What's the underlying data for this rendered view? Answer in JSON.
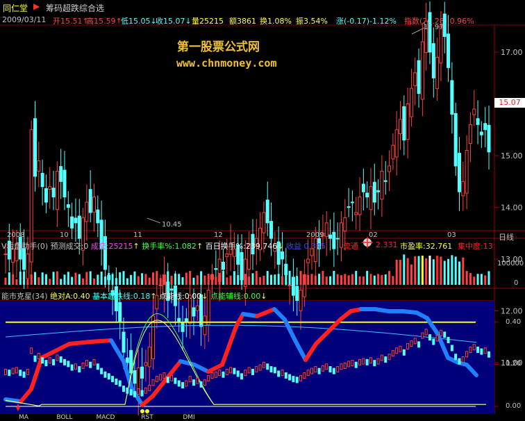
{
  "titlebar": {
    "stock_name": "同仁堂",
    "indicator_name": "筹码超跌综合选"
  },
  "quote": {
    "date": "2009/03/11",
    "open_label": "开",
    "open": "15.51",
    "high_label": "高",
    "high": "15.59",
    "low_label": "低",
    "low": "15.05",
    "close_label": "收",
    "close": "15.07",
    "vol_label": "量",
    "vol": "25215",
    "amt_label": "额",
    "amt": "3861",
    "turn_label": "换",
    "turn": "1.08%",
    "amp_label": "振",
    "amp": "3.54%",
    "chg_label": "涨",
    "chg": "(-0.17)-1.12%",
    "index_label": "指数",
    "index": "(20.28)",
    "index_pct": "0.96%"
  },
  "watermark": {
    "line1": "第一股票公式网",
    "line2": "www.chnmoney.com"
  },
  "price_panel": {
    "y_ticks": [
      "17.00",
      "16.00",
      "15.00",
      "14.00",
      "13.00",
      "12.00",
      "11.00"
    ],
    "current_price": "15.07",
    "max_label": "17.97",
    "min_label": "10.45"
  },
  "date_axis": {
    "labels": [
      "2008",
      "10",
      "11",
      "12",
      "2009",
      "02",
      "03"
    ],
    "period": "日线"
  },
  "volume_panel": {
    "name": "V看盘助手(0)",
    "forecast_label": "预测成交:0",
    "vol_label": "成交:",
    "vol": "25215",
    "turn_label": "换手率%:",
    "turn": "1.082",
    "hundred_label": "百日换手%:",
    "hundred": "239.746",
    "ret_label": "收益",
    "ret": "0.345",
    "float_label": "流通",
    "float_val": "2.331",
    "pe_label": "市盈率:",
    "pe": "32.761",
    "conc_label": "集中度:",
    "conc": "13",
    "y_ticks": [
      "100000",
      "0"
    ]
  },
  "indicator_panel": {
    "name": "能市克星(34)",
    "abs_label": "绝对A:",
    "abs": "0.40",
    "base_label": "基本超跌线:",
    "base": "0.18",
    "dot_label": "点能线:",
    "dot": "0.00",
    "aux_label": "点能辅线:",
    "aux": "0.00",
    "y_ticks": [
      "0.40",
      "0.20",
      "0.00"
    ]
  },
  "bottom_tabs": [
    "MA",
    "BOLL",
    "MACD",
    "RST",
    "DMI"
  ],
  "colors": {
    "up": "#ff4040",
    "down": "#54ffff",
    "yellow": "#ffff00",
    "panel_bg": "#00007a",
    "label_red": "#ff2020"
  }
}
